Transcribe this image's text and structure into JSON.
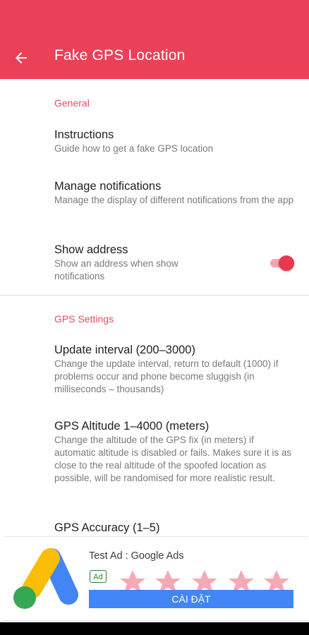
{
  "appbar": {
    "title": "Fake GPS Location",
    "back_icon": "arrow-back-icon",
    "color": "#ea4159"
  },
  "general": {
    "header": "General",
    "items": [
      {
        "title": "Instructions",
        "subtitle": "Guide how to get a fake GPS location"
      },
      {
        "title": "Manage notifications",
        "subtitle": "Manage the display of different notifications from the app"
      },
      {
        "title": "Show address",
        "subtitle": "Show an address when show notifications",
        "toggle_on": true
      }
    ]
  },
  "gps_settings": {
    "header": "GPS Settings",
    "items": [
      {
        "title": "Update interval (200–3000)",
        "subtitle": "Change the update interval, return to default (1000) if problems occur and phone become sluggish (in milliseconds – thousands)"
      },
      {
        "title": "GPS Altitude 1–4000 (meters)",
        "subtitle": "Change the altitude of the GPS fix (in meters) if automatic altitude is disabled or fails. Makes sure it is as close to the real altitude of the spoofed location as possible, will be randomised for more realistic result."
      },
      {
        "title": "GPS Accuracy (1–5)"
      }
    ]
  },
  "ad": {
    "title": "Test Ad : Google Ads",
    "badge": "Ad",
    "cta": "CÀI ĐẶT",
    "logo_icon": "google-ads-logo-icon",
    "rating_stars": 5
  }
}
